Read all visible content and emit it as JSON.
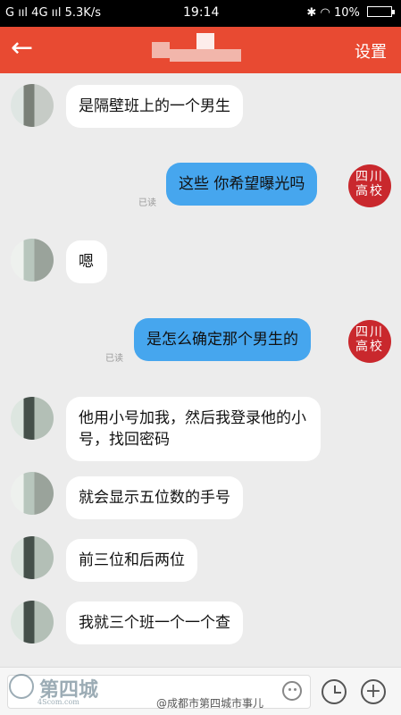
{
  "status_bar": {
    "network_left": "G ııl 4G ııl 5.3K/s",
    "time": "19:14",
    "battery_percent": "10%"
  },
  "header": {
    "back_icon": "arrow-left-icon",
    "settings_label": "设置"
  },
  "messages": [
    {
      "side": "in",
      "text": "是隔壁班上的一个男生"
    },
    {
      "side": "out",
      "text": "这些 你希望曝光吗",
      "read_label": "已读",
      "avatar_text": [
        "四川",
        "高校"
      ]
    },
    {
      "side": "in",
      "text": "嗯"
    },
    {
      "side": "out",
      "text": "是怎么确定那个男生的",
      "read_label": "已读",
      "avatar_text": [
        "四川",
        "高校"
      ]
    },
    {
      "side": "in",
      "text": "他用小号加我，然后我登录他的小号，找回密码"
    },
    {
      "side": "in",
      "text": "就会显示五位数的手号"
    },
    {
      "side": "in",
      "text": "前三位和后两位"
    },
    {
      "side": "in",
      "text": "我就三个班一个一个查"
    }
  ],
  "composer": {
    "emoji_icon": "emoji-icon",
    "history_icon": "clock-icon",
    "add_icon": "plus-icon"
  },
  "watermark": {
    "brand": "第四城",
    "brand_small": "4Scom.com",
    "weibo": "@成都市第四城市事儿"
  }
}
